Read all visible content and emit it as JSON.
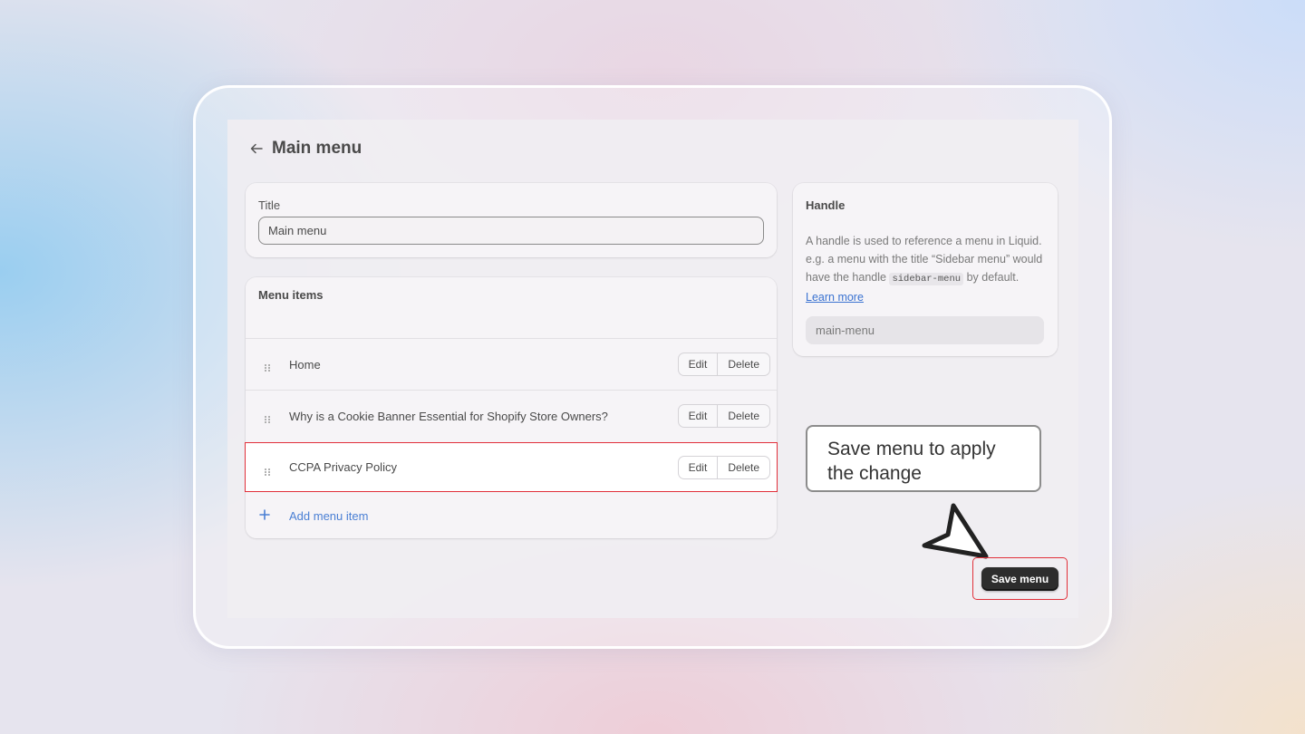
{
  "page": {
    "title": "Main menu",
    "back_icon": "arrow-left-icon"
  },
  "title_card": {
    "label": "Title",
    "value": "Main menu"
  },
  "menu_items": {
    "heading": "Menu items",
    "items": [
      {
        "label": "Home",
        "edit": "Edit",
        "delete": "Delete"
      },
      {
        "label": "Why is a Cookie Banner Essential for Shopify Store Owners?",
        "edit": "Edit",
        "delete": "Delete"
      },
      {
        "label": "CCPA Privacy Policy",
        "edit": "Edit",
        "delete": "Delete",
        "highlighted": true
      }
    ],
    "add_label": "Add menu item"
  },
  "handle": {
    "title": "Handle",
    "desc_part1": "A handle is used to reference a menu in Liquid. e.g. a menu with the title “Sidebar menu” would have the handle",
    "code": "sidebar-menu",
    "desc_part2": "by default.",
    "link": "Learn more",
    "value": "main-menu"
  },
  "tooltip": {
    "text": "Save menu to apply the change"
  },
  "actions": {
    "save_label": "Save menu"
  },
  "colors": {
    "highlight": "#e1303a",
    "link": "#3b73d1",
    "primary_button": "#2d2d2d"
  }
}
